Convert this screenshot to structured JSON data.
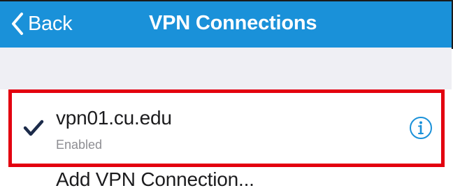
{
  "nav": {
    "back_label": "Back",
    "title": "VPN Connections",
    "color": "#1a91d9"
  },
  "vpn": {
    "name": "vpn01.cu.edu",
    "status": "Enabled",
    "selected": true
  },
  "add_connection_label": "Add VPN Connection...",
  "icons": {
    "back": "chevron-left-icon",
    "check": "checkmark-icon",
    "info": "info-circle-icon"
  },
  "colors": {
    "accent": "#1a91d9",
    "highlight": "#e3000f",
    "section_gap": "#efeff4"
  }
}
